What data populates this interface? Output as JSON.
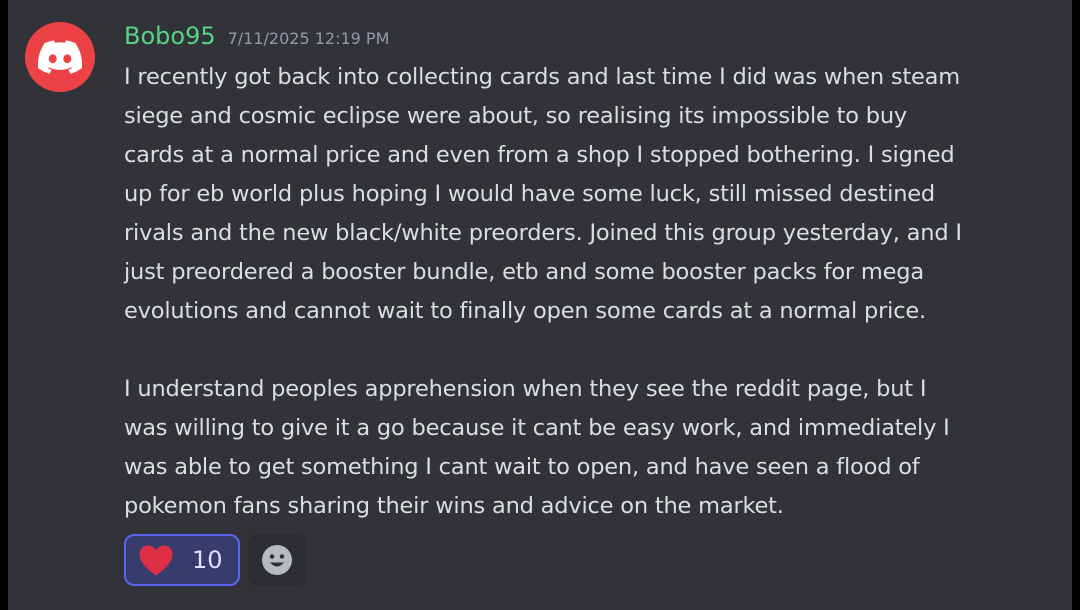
{
  "message": {
    "username": "Bobo95",
    "timestamp": "7/11/2025 12:19 PM",
    "avatar_icon": "discord-logo-icon",
    "paragraphs": [
      {
        "lines": [
          "I recently got back into collecting cards and last time I did was when steam",
          "siege and cosmic eclipse were about, so realising its impossible to buy",
          "cards at a normal price and even from a shop I stopped bothering. I signed",
          "up for eb world plus hoping I would have some luck, still missed destined",
          "rivals and the new black/white preorders. Joined this group yesterday, and I",
          "just preordered a booster bundle, etb and some booster packs for mega",
          "evolutions and cannot wait to finally open some cards at a normal price."
        ]
      },
      {
        "lines": [
          "I understand peoples apprehension when they see the reddit page, but I",
          "was willing to give it a go because it cant be easy work, and immediately I",
          "was able to get something I cant wait to open, and have seen a flood of",
          "pokemon fans sharing their wins and advice on the market."
        ]
      }
    ]
  },
  "reactions": [
    {
      "emoji": "heart-icon",
      "count": "10"
    }
  ],
  "add_reaction_icon": "smiley-face-icon",
  "colors": {
    "username": "#57d383",
    "timestamp": "#949ba4",
    "text": "#dbdee1",
    "background": "#313338",
    "avatar": "#ed4245",
    "reaction_bg": "#383c6d",
    "reaction_border": "#5865f2",
    "heart": "#dd2e44"
  }
}
